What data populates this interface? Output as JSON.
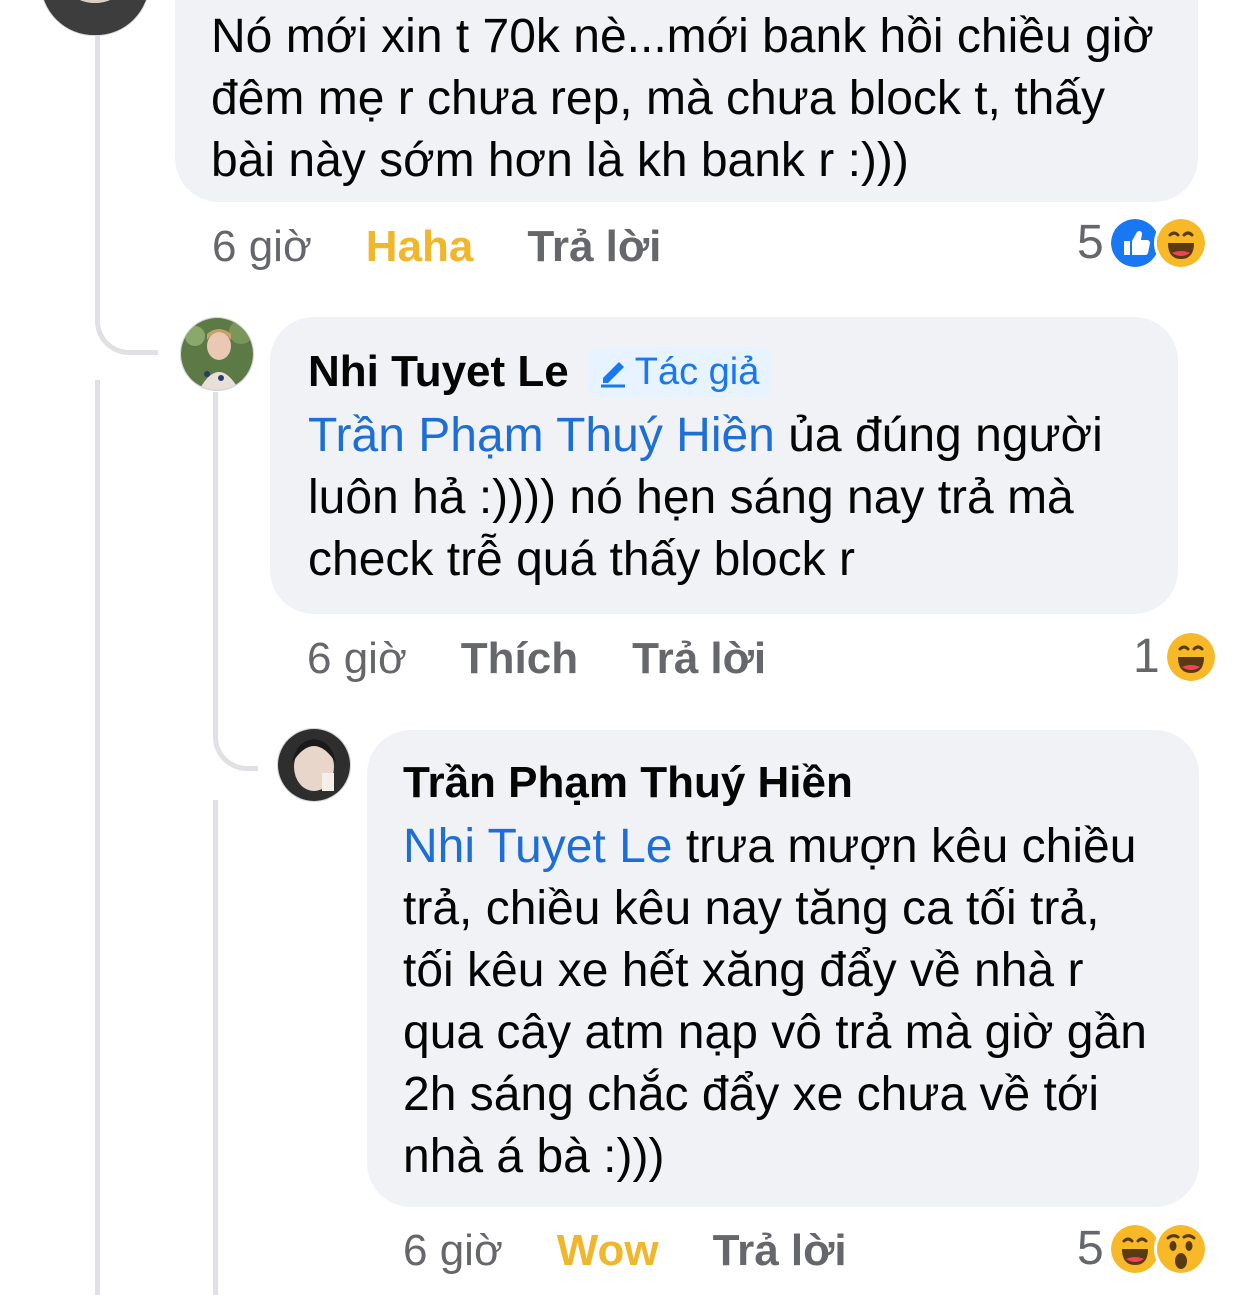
{
  "comments": [
    {
      "text": "Nó mới xin t 70k nè...mới bank hồi chiều giờ đêm mẹ r chưa rep, mà chưa block t, thấy bài này sớm hơn là kh bank r :)))",
      "time": "6 giờ",
      "react_label": "Haha",
      "reply_label": "Trả lời",
      "reaction_count": "5",
      "reaction_icons": [
        "like-icon",
        "haha-icon"
      ]
    },
    {
      "author": "Nhi Tuyet Le",
      "badge": "Tác giả",
      "mention": "Trần Phạm Thuý Hiền",
      "text": "ủa đúng người luôn hả :)))) nó hẹn sáng nay trả mà check trễ quá thấy block r",
      "time": "6 giờ",
      "react_label": "Thích",
      "reply_label": "Trả lời",
      "reaction_count": "1",
      "reaction_icons": [
        "haha-icon"
      ]
    },
    {
      "author": "Trần Phạm Thuý Hiền",
      "mention": "Nhi Tuyet Le",
      "text": "trưa mượn kêu chiều trả, chiều kêu nay tăng ca tối trả, tối kêu xe hết xăng đẩy về nhà r qua cây atm nạp vô trả mà giờ gần 2h sáng chắc đẩy xe chưa về tới nhà á bà :)))",
      "time": "6 giờ",
      "react_label": "Wow",
      "reply_label": "Trả lời",
      "reaction_count": "5",
      "reaction_icons": [
        "haha-icon",
        "wow-icon"
      ]
    }
  ],
  "colors": {
    "bubble": "#f0f2f5",
    "mention": "#1d6fd6",
    "meta": "#65676b",
    "reaction_active": "#f0b62c",
    "thread_line": "#dfe1e5"
  }
}
